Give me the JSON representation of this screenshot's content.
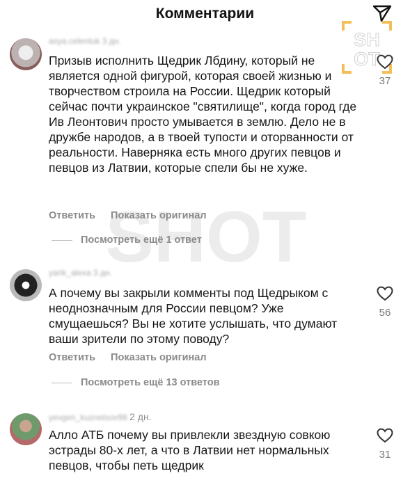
{
  "header": {
    "title": "Комментарии"
  },
  "logo": {
    "lines": [
      "SH",
      "OT"
    ]
  },
  "watermark": {
    "text": "SHOT"
  },
  "comments": [
    {
      "username": "asya.celentuk",
      "time": "3 дн.",
      "text": "Призыв исполнить Щедрик Лбдину, который не является одной фигурой, которая своей жизнью и творчеством строила на России. Щедрик который сейчас почти украинское \"святилище\", когда город где Ив Леонтович просто умывается в землю. Дело не в дружбе народов, а в твоей тупости и оторванности от реальности. Наверняка есть много других певцов и певцов из Латвии, которые спели бы не хуже.",
      "reply": "Ответить",
      "show_original": "Показать оригинал",
      "more_replies": "Посмотреть ещё 1 ответ",
      "likes": "37"
    },
    {
      "username": "yarik_alexa",
      "time": "3 дн.",
      "text": "А почему вы закрыли комменты под Щедрыком с неоднозначным для России певцом? Уже смущаешься? Вы не хотите услышать, что думают ваши зрители по этому поводу?",
      "reply": "Ответить",
      "show_original": "Показать оригинал",
      "more_replies": "Посмотреть ещё 13 ответов",
      "likes": "56"
    },
    {
      "username": "yevgen_kuznetsov98",
      "time": "2 дн.",
      "text": "Алло АТБ почему вы привлекли звездную совкою эстрады 80-х лет, а что в Латвии нет нормальных певцов, чтобы петь щедрик",
      "likes": "31"
    }
  ]
}
